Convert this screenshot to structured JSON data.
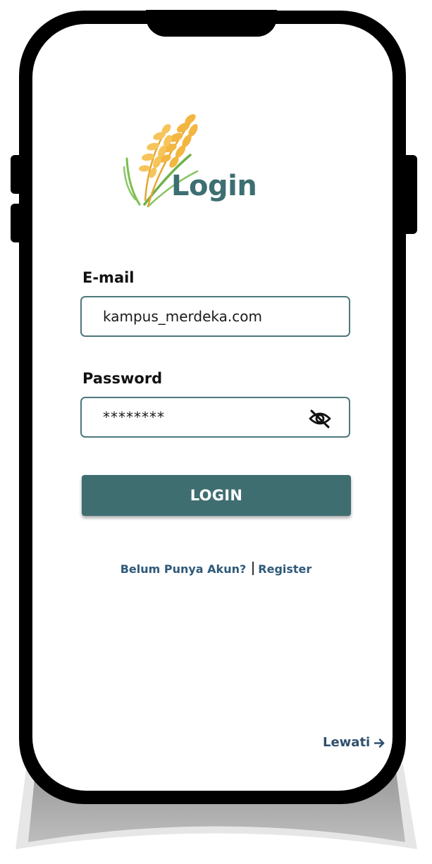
{
  "header": {
    "title": "Login"
  },
  "form": {
    "email_label": "E-mail",
    "email_value": "kampus_merdeka.com",
    "password_label": "Password",
    "password_value": "********",
    "password_toggle_icon": "eye-slash-icon"
  },
  "actions": {
    "login_label": "LOGIN",
    "no_account_text": "Belum Punya Akun?",
    "register_label": "Register",
    "skip_label": "Lewati",
    "skip_icon": "arrow-right-icon"
  },
  "colors": {
    "primary": "#3f6e71",
    "input_border": "#4d787c",
    "link": "#2f5a78",
    "wheat": "#f3b640",
    "leaf": "#6fb24a"
  }
}
